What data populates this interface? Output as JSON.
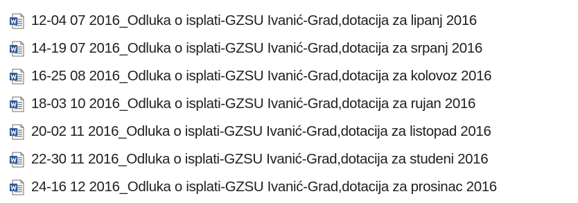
{
  "files": [
    {
      "name": "12-04 07 2016_Odluka o isplati-GZSU Ivanić-Grad,dotacija za lipanj 2016",
      "icon": "word-document-icon"
    },
    {
      "name": "14-19 07 2016_Odluka o isplati-GZSU Ivanić-Grad,dotacija za srpanj 2016",
      "icon": "word-document-icon"
    },
    {
      "name": "16-25 08 2016_Odluka o isplati-GZSU Ivanić-Grad,dotacija za kolovoz 2016",
      "icon": "word-document-icon"
    },
    {
      "name": "18-03 10 2016_Odluka o isplati-GZSU Ivanić-Grad,dotacija za rujan 2016",
      "icon": "word-document-icon"
    },
    {
      "name": "20-02 11 2016_Odluka o isplati-GZSU Ivanić-Grad,dotacija za listopad 2016",
      "icon": "word-document-icon"
    },
    {
      "name": "22-30 11 2016_Odluka o isplati-GZSU Ivanić-Grad,dotacija za studeni 2016",
      "icon": "word-document-icon"
    },
    {
      "name": "24-16 12 2016_Odluka o isplati-GZSU Ivanić-Grad,dotacija za prosinac 2016",
      "icon": "word-document-icon"
    }
  ],
  "colors": {
    "text": "#202020",
    "icon_blue": "#2b579a",
    "icon_paper": "#ffffff",
    "icon_outline": "#6b6b6b"
  }
}
